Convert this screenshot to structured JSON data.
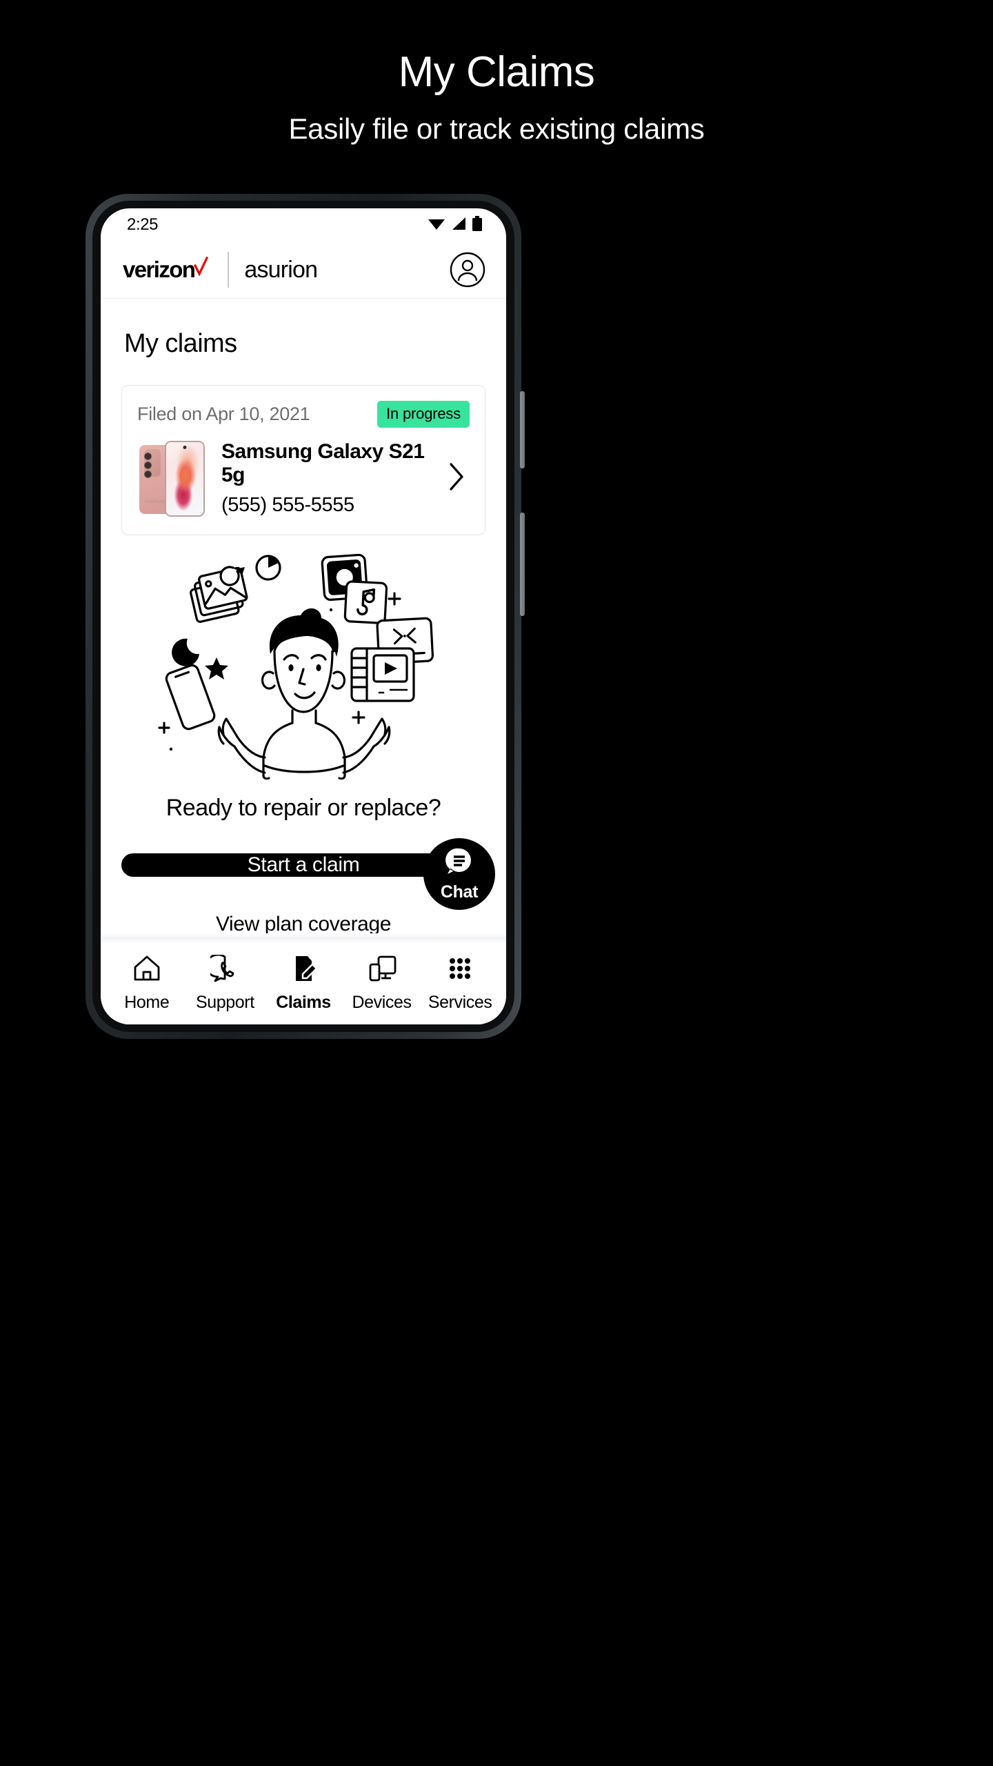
{
  "promo": {
    "title": "My Claims",
    "subtitle": "Easily file or track existing claims"
  },
  "colors": {
    "background": "#000000",
    "screen": "#ffffff",
    "badge_green": "#38E39C",
    "verizon_red": "#ee0000",
    "muted_text": "#6e6e6e",
    "card_border": "#e3e3e3"
  },
  "statusbar": {
    "time": "2:25",
    "icons": [
      "wifi-icon",
      "signal-icon",
      "battery-icon"
    ]
  },
  "appbar": {
    "verizon_label": "verizon",
    "asurion_label": "asurion",
    "account_icon": "account-circle-icon"
  },
  "page": {
    "title": "My claims"
  },
  "claim": {
    "filed_label": "Filed on Apr 10, 2021",
    "status_label": "In progress",
    "device_name": "Samsung Galaxy S21 5g",
    "device_phone": "(555) 555-5555",
    "chevron_icon": "chevron-right-icon",
    "thumbnail_icon": "samsung-galaxy-s21-phone-image"
  },
  "illustration": {
    "name": "person-juggling-media-icons-illustration",
    "elements": [
      "photos-icon",
      "pie-chart-icon",
      "camera-icon",
      "music-note-icon",
      "video-player-icon",
      "broken-screen-icon",
      "smartphone-icon",
      "moon-icon",
      "star-icon",
      "plus-icon"
    ]
  },
  "cta": {
    "heading": "Ready to repair or replace?",
    "primary_button": "Start a claim",
    "secondary_link": "View plan coverage"
  },
  "chat": {
    "label": "Chat",
    "icon": "chat-bubble-icon"
  },
  "bottom_nav": {
    "items": [
      {
        "label": "Home",
        "icon": "home-icon",
        "active": false
      },
      {
        "label": "Support",
        "icon": "support-icon",
        "active": false
      },
      {
        "label": "Claims",
        "icon": "claims-icon",
        "active": true
      },
      {
        "label": "Devices",
        "icon": "devices-icon",
        "active": false
      },
      {
        "label": "Services",
        "icon": "services-grid-icon",
        "active": false
      }
    ]
  }
}
